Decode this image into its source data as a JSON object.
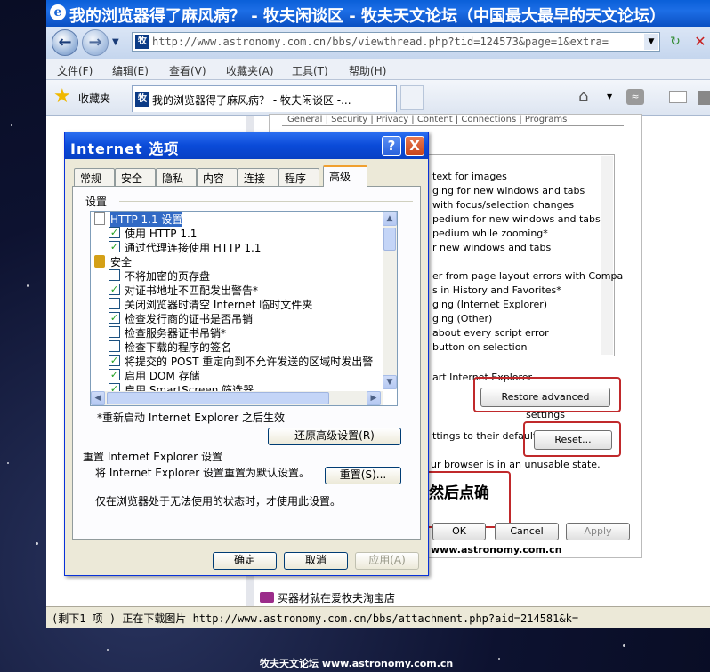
{
  "window": {
    "title": "我的浏览器得了麻风病？ - 牧夫闲谈区 - 牧夫天文论坛（中国最大最早的天文论坛）",
    "url": "http://www.astronomy.com.cn/bbs/viewthread.php?tid=124573&page=1&extra=",
    "menu": [
      "文件(F)",
      "编辑(E)",
      "查看(V)",
      "收藏夹(A)",
      "工具(T)",
      "帮助(H)"
    ],
    "favorites_label": "收藏夹",
    "tab_title": "我的浏览器得了麻风病？ - 牧夫闲谈区 -...",
    "status": "(剩下1 项 ) 正在下载图片 http://www.astronomy.com.cn/bbs/attachment.php?aid=214581&k=",
    "ad_text": "买器材就在爱牧夫淘宝店",
    "watermark": "牧夫天文论坛 www.astronomy.com.cn"
  },
  "embedded": {
    "tabs": "General | Security | Privacy | Content | Connections | Programs",
    "lines": [
      "text for images",
      "ging for new windows and tabs",
      " with focus/selection changes",
      "pedium for new windows and tabs",
      "pedium while zooming*",
      "r new windows and tabs",
      "",
      "er from page layout errors with Compa",
      "s in History and Favorites*",
      "ging (Internet Explorer)",
      "ging (Other)",
      " about every script error",
      "button on selection"
    ],
    "restart_text": "art Internet Explorer",
    "restore_btn": "Restore advanced settings",
    "reset_text": "ttings to their default",
    "reset_btn": "Reset...",
    "unusable_text": "ur browser is in an unusable state.",
    "callout": "然后点确",
    "ok_btn": "OK",
    "cancel_btn": "Cancel",
    "apply_btn": "Apply",
    "site": "www.astronomy.com.cn"
  },
  "dialog": {
    "title": "Internet 选项",
    "tabs": [
      "常规",
      "安全",
      "隐私",
      "内容",
      "连接",
      "程序",
      "高级"
    ],
    "settings_label": "设置",
    "tree": [
      {
        "type": "header",
        "label": "HTTP 1.1 设置",
        "checked": null
      },
      {
        "type": "check",
        "label": "使用 HTTP 1.1",
        "checked": true
      },
      {
        "type": "check",
        "label": "通过代理连接使用 HTTP 1.1",
        "checked": true
      },
      {
        "type": "header2",
        "label": "安全",
        "checked": null
      },
      {
        "type": "check",
        "label": "不将加密的页存盘",
        "checked": false
      },
      {
        "type": "check",
        "label": "对证书地址不匹配发出警告*",
        "checked": true
      },
      {
        "type": "check",
        "label": "关闭浏览器时清空 Internet 临时文件夹",
        "checked": false
      },
      {
        "type": "check",
        "label": "检查发行商的证书是否吊销",
        "checked": true
      },
      {
        "type": "check",
        "label": "检查服务器证书吊销*",
        "checked": false
      },
      {
        "type": "check",
        "label": "检查下载的程序的签名",
        "checked": false
      },
      {
        "type": "check",
        "label": "将提交的 POST 重定向到不允许发送的区域时发出警",
        "checked": true
      },
      {
        "type": "check",
        "label": "启用 DOM 存储",
        "checked": true
      },
      {
        "type": "check",
        "label": "启用 SmartScreen 筛选器",
        "checked": true
      }
    ],
    "restart_note": "*重新启动 Internet Explorer 之后生效",
    "restore_btn": "还原高级设置(R)",
    "reset_group": "重置 Internet Explorer 设置",
    "reset_desc": "将 Internet Explorer 设置重置为默认设置。",
    "reset_btn": "重置(S)...",
    "unusable_note": "仅在浏览器处于无法使用的状态时，才使用此设置。",
    "ok_btn": "确定",
    "cancel_btn": "取消",
    "apply_btn": "应用(A)",
    "help_btn": "?",
    "close_btn": "X"
  }
}
